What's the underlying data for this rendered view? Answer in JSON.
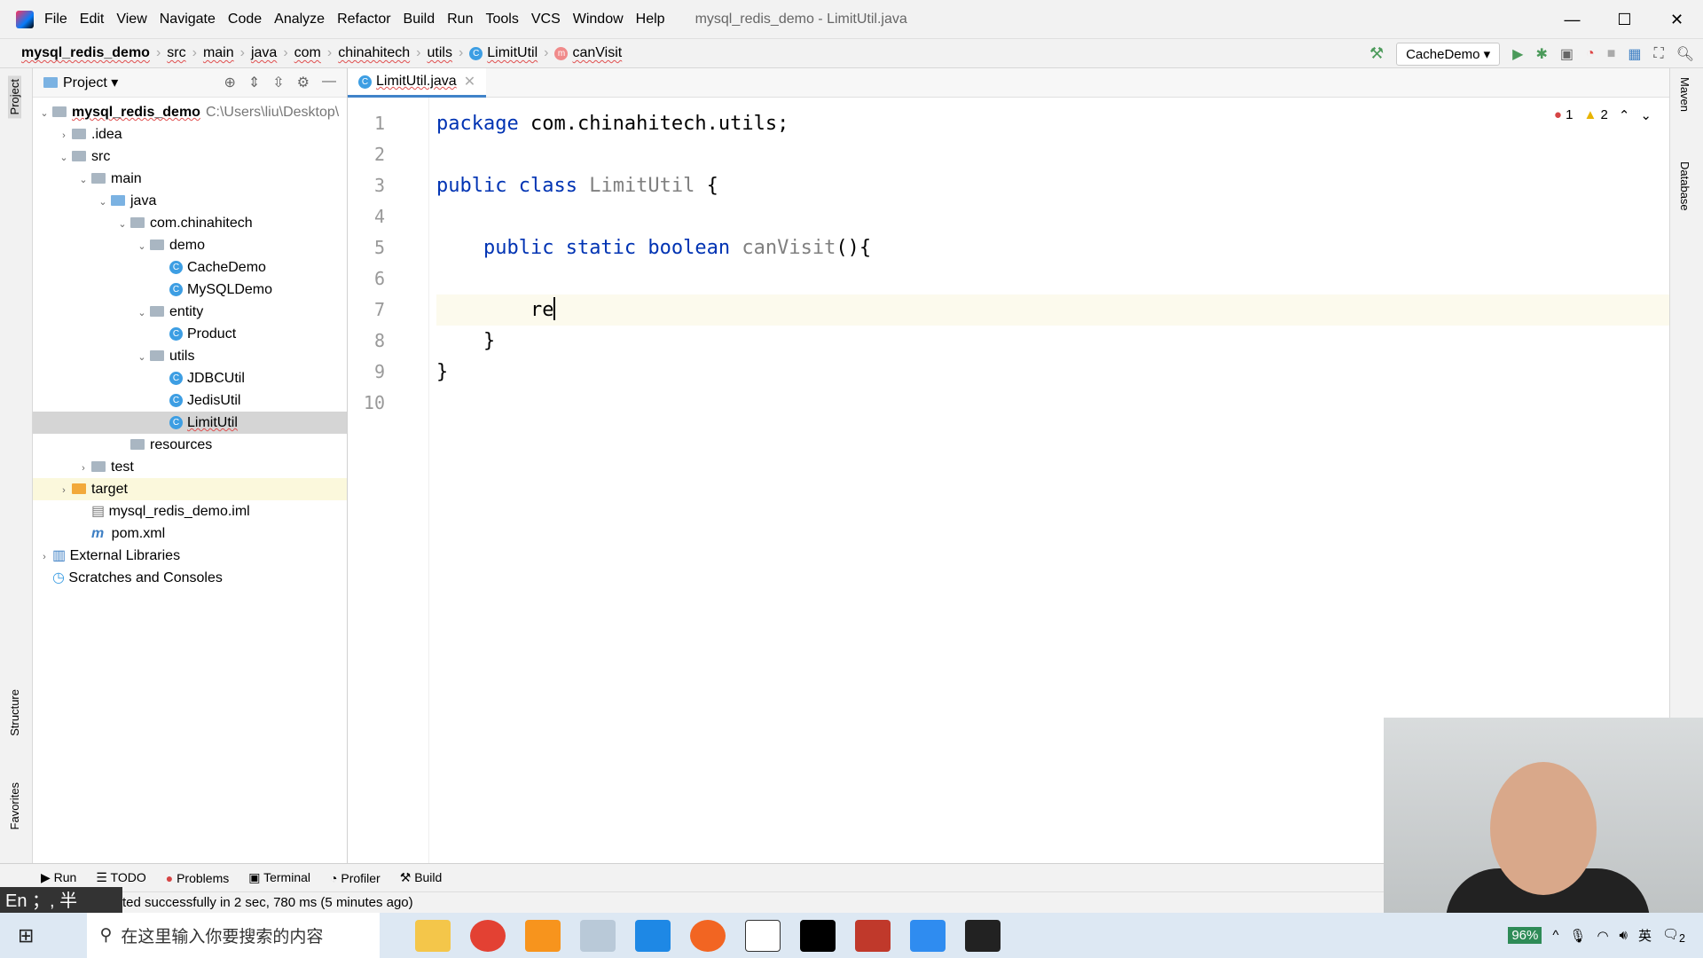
{
  "menu": [
    "File",
    "Edit",
    "View",
    "Navigate",
    "Code",
    "Analyze",
    "Refactor",
    "Build",
    "Run",
    "Tools",
    "VCS",
    "Window",
    "Help"
  ],
  "window_title": "mysql_redis_demo - LimitUtil.java",
  "breadcrumb": {
    "project": "mysql_redis_demo",
    "items": [
      "src",
      "main",
      "java",
      "com",
      "chinahitech",
      "utils"
    ],
    "class": "LimitUtil",
    "method": "canVisit"
  },
  "run_config": "CacheDemo",
  "project_panel": {
    "title": "Project",
    "tree": [
      {
        "label": "mysql_redis_demo",
        "path": "C:\\Users\\liu\\Desktop\\",
        "depth": 0,
        "arrow": "v",
        "bold": true,
        "icon": "module"
      },
      {
        "label": ".idea",
        "depth": 1,
        "arrow": ">",
        "icon": "folder"
      },
      {
        "label": "src",
        "depth": 1,
        "arrow": "v",
        "icon": "folder"
      },
      {
        "label": "main",
        "depth": 2,
        "arrow": "v",
        "icon": "folder"
      },
      {
        "label": "java",
        "depth": 3,
        "arrow": "v",
        "icon": "folder-blue"
      },
      {
        "label": "com.chinahitech",
        "depth": 4,
        "arrow": "v",
        "icon": "package"
      },
      {
        "label": "demo",
        "depth": 5,
        "arrow": "v",
        "icon": "package"
      },
      {
        "label": "CacheDemo",
        "depth": 6,
        "icon": "class"
      },
      {
        "label": "MySQLDemo",
        "depth": 6,
        "icon": "class"
      },
      {
        "label": "entity",
        "depth": 5,
        "arrow": "v",
        "icon": "package"
      },
      {
        "label": "Product",
        "depth": 6,
        "icon": "class"
      },
      {
        "label": "utils",
        "depth": 5,
        "arrow": "v",
        "icon": "package"
      },
      {
        "label": "JDBCUtil",
        "depth": 6,
        "icon": "class"
      },
      {
        "label": "JedisUtil",
        "depth": 6,
        "icon": "class"
      },
      {
        "label": "LimitUtil",
        "depth": 6,
        "icon": "class",
        "selected": true
      },
      {
        "label": "resources",
        "depth": 4,
        "icon": "folder"
      },
      {
        "label": "test",
        "depth": 2,
        "arrow": ">",
        "icon": "folder"
      },
      {
        "label": "target",
        "depth": 1,
        "arrow": ">",
        "icon": "folder-orange",
        "highlight": true
      },
      {
        "label": "mysql_redis_demo.iml",
        "depth": 2,
        "icon": "file"
      },
      {
        "label": "pom.xml",
        "depth": 2,
        "icon": "maven"
      },
      {
        "label": "External Libraries",
        "depth": 0,
        "arrow": ">",
        "icon": "library"
      },
      {
        "label": "Scratches and Consoles",
        "depth": 0,
        "icon": "scratch"
      }
    ]
  },
  "editor": {
    "tab": "LimitUtil.java",
    "errors": "1",
    "warnings": "2",
    "lines": [
      [
        {
          "t": "package",
          "c": "kw"
        },
        {
          "t": " com.chinahitech.utils;"
        }
      ],
      [],
      [
        {
          "t": "public class",
          "c": "kw"
        },
        {
          "t": " "
        },
        {
          "t": "LimitUtil",
          "c": "gray"
        },
        {
          "t": " {"
        }
      ],
      [],
      [
        {
          "t": "    "
        },
        {
          "t": "public static boolean",
          "c": "kw"
        },
        {
          "t": " "
        },
        {
          "t": "canVisit",
          "c": "gray"
        },
        {
          "t": "(){"
        }
      ],
      [],
      [
        {
          "t": "        re"
        }
      ],
      [
        {
          "t": "    }"
        }
      ],
      [
        {
          "t": "}"
        }
      ],
      []
    ],
    "current_line": 7
  },
  "left_stripe": {
    "project": "Project",
    "structure": "Structure",
    "favorites": "Favorites"
  },
  "right_stripe": {
    "maven": "Maven",
    "database": "Database"
  },
  "bottom_tabs": [
    "Run",
    "TODO",
    "Problems",
    "Terminal",
    "Profiler",
    "Build"
  ],
  "status": "ted successfully in 2 sec, 780 ms (5 minutes ago)",
  "ime": "En ；, 半",
  "taskbar": {
    "search_placeholder": "在这里输入你要搜索的内容",
    "battery": "96%",
    "ime_tray": "英",
    "notifications": "2"
  }
}
